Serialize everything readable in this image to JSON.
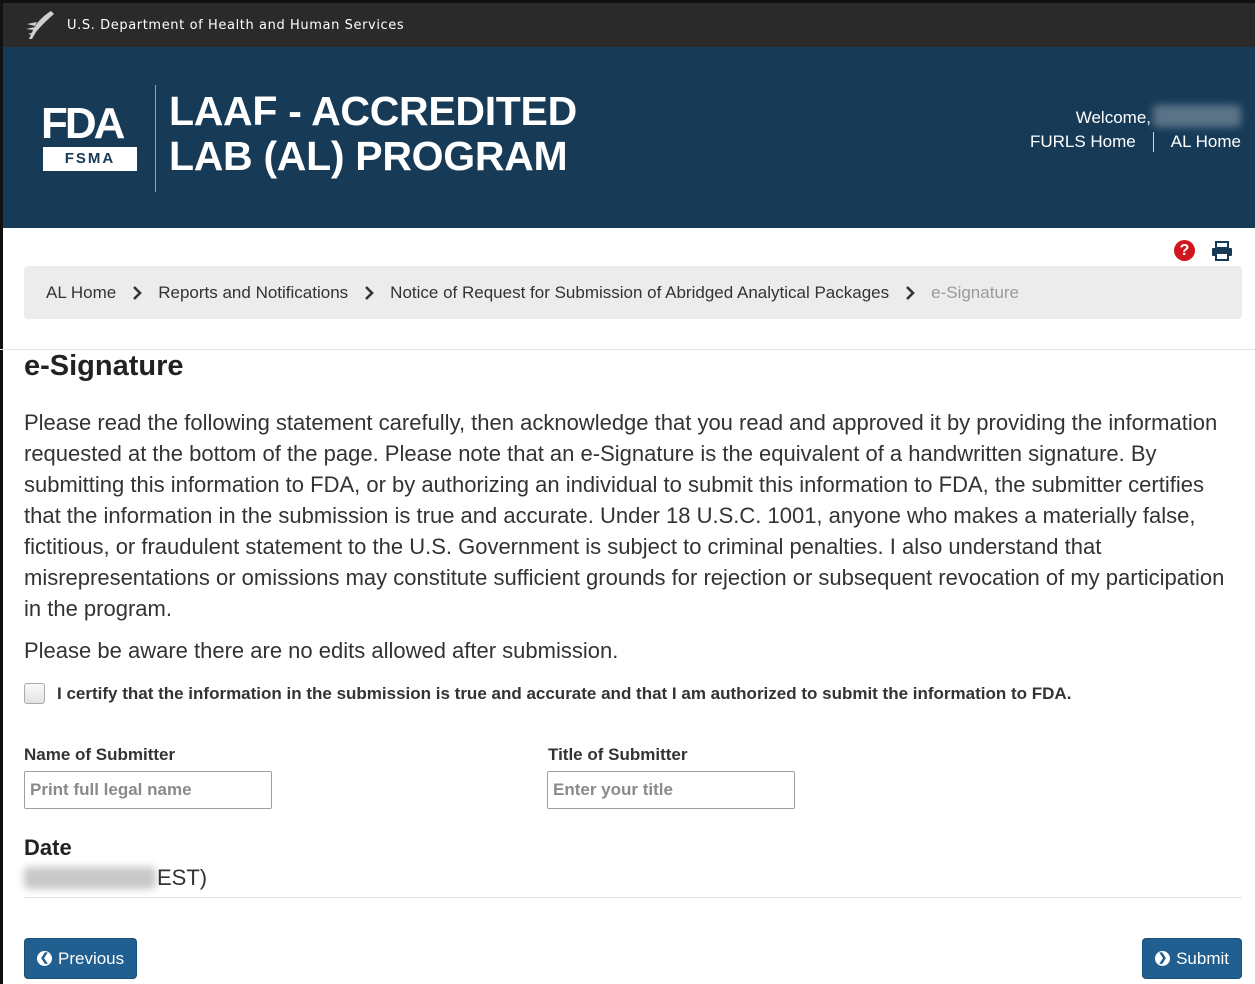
{
  "hhs_bar": {
    "text": "U.S. Department of Health and Human Services"
  },
  "header": {
    "logo_fda": "FDA",
    "logo_fsma": "FSMA",
    "title_line1": "LAAF - ACCREDITED",
    "title_line2": "LAB (AL) PROGRAM",
    "welcome": "Welcome,",
    "links": {
      "furls_home": "FURLS Home",
      "al_home": "AL Home"
    }
  },
  "utility_icons": {
    "help": "?",
    "help_icon_color": "#d0161e",
    "print_icon": "printer-icon"
  },
  "breadcrumb": [
    "AL Home",
    "Reports and Notifications",
    "Notice of Request for Submission of Abridged Analytical Packages",
    "e-Signature"
  ],
  "main": {
    "title": "e-Signature",
    "statement": "Please read the following statement carefully, then acknowledge that you read and approved it by providing the information requested at the bottom of the page. Please note that an e-Signature is the equivalent of a handwritten signature. By submitting this information to FDA, or by authorizing an individual to submit this information to FDA, the submitter certifies that the information in the submission is true and accurate. Under 18 U.S.C. 1001, anyone who makes a materially false, fictitious, or fraudulent statement to the U.S. Government is subject to criminal penalties. I also understand that misrepresentations or omissions may constitute sufficient grounds for rejection or subsequent revocation of my participation in the program.",
    "no_edits": "Please be aware there are no edits allowed after submission.",
    "certify_label": "I certify that the information in the submission is true and accurate and that I am authorized to submit the information to FDA.",
    "certify_checked": false,
    "name_label": "Name of Submitter",
    "name_placeholder": "Print full legal name",
    "name_value": "",
    "title_label": "Title of Submitter",
    "title_placeholder": "Enter your title",
    "title_value": "",
    "date_label": "Date",
    "date_suffix": "EST)"
  },
  "buttons": {
    "previous": "Previous",
    "submit": "Submit"
  },
  "colors": {
    "banner": "#173b57",
    "top_bar": "#2a2a2a",
    "button": "#205f8f"
  }
}
